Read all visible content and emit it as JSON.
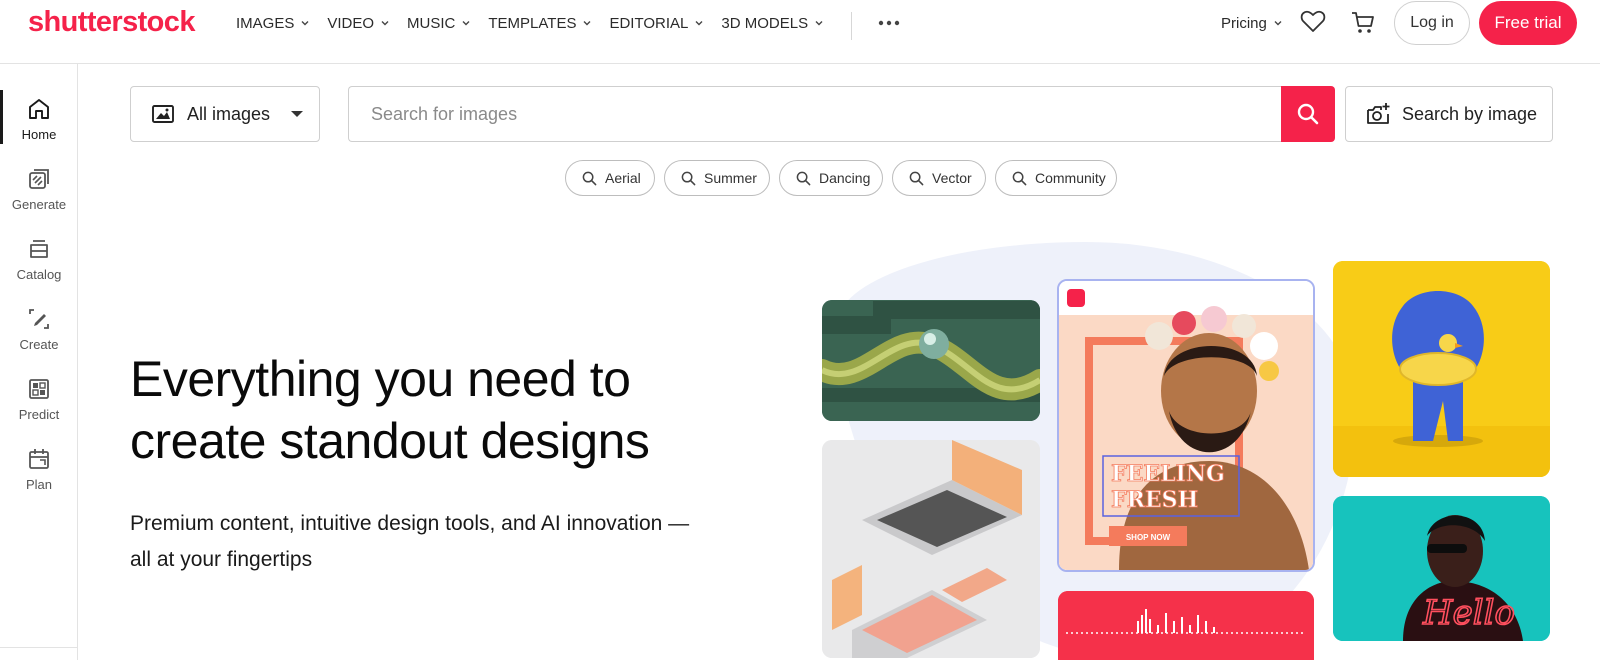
{
  "brand": {
    "logo": "shutterstock",
    "accent": "#f5224a"
  },
  "nav": {
    "items": [
      {
        "label": "IMAGES"
      },
      {
        "label": "VIDEO"
      },
      {
        "label": "MUSIC"
      },
      {
        "label": "TEMPLATES"
      },
      {
        "label": "EDITORIAL"
      },
      {
        "label": "3D MODELS"
      }
    ],
    "more_icon": "more-horizontal-icon",
    "pricing": "Pricing",
    "favorites_icon": "heart-icon",
    "cart_icon": "cart-icon",
    "login": "Log in",
    "free_trial": "Free trial"
  },
  "sidebar": {
    "items": [
      {
        "label": "Home",
        "icon": "home-icon",
        "active": true
      },
      {
        "label": "Generate",
        "icon": "generate-icon"
      },
      {
        "label": "Catalog",
        "icon": "catalog-icon"
      },
      {
        "label": "Create",
        "icon": "create-icon"
      },
      {
        "label": "Predict",
        "icon": "predict-icon"
      },
      {
        "label": "Plan",
        "icon": "plan-icon"
      }
    ]
  },
  "search": {
    "type_select": "All images",
    "placeholder": "Search for images",
    "value": "",
    "search_by_image": "Search by image"
  },
  "chips": [
    "Aerial",
    "Summer",
    "Dancing",
    "Vector",
    "Community"
  ],
  "hero": {
    "title_line1": "Everything you need to",
    "title_line2": "create standout designs",
    "subtitle_line1": "Premium content, intuitive design tools, and AI innovation —",
    "subtitle_line2": "all at your fingertips"
  },
  "collage": {
    "poster_title_line1": "FEELING",
    "poster_title_line2": "FRESH",
    "poster_button": "SHOP NOW",
    "neon_text": "Hello"
  }
}
